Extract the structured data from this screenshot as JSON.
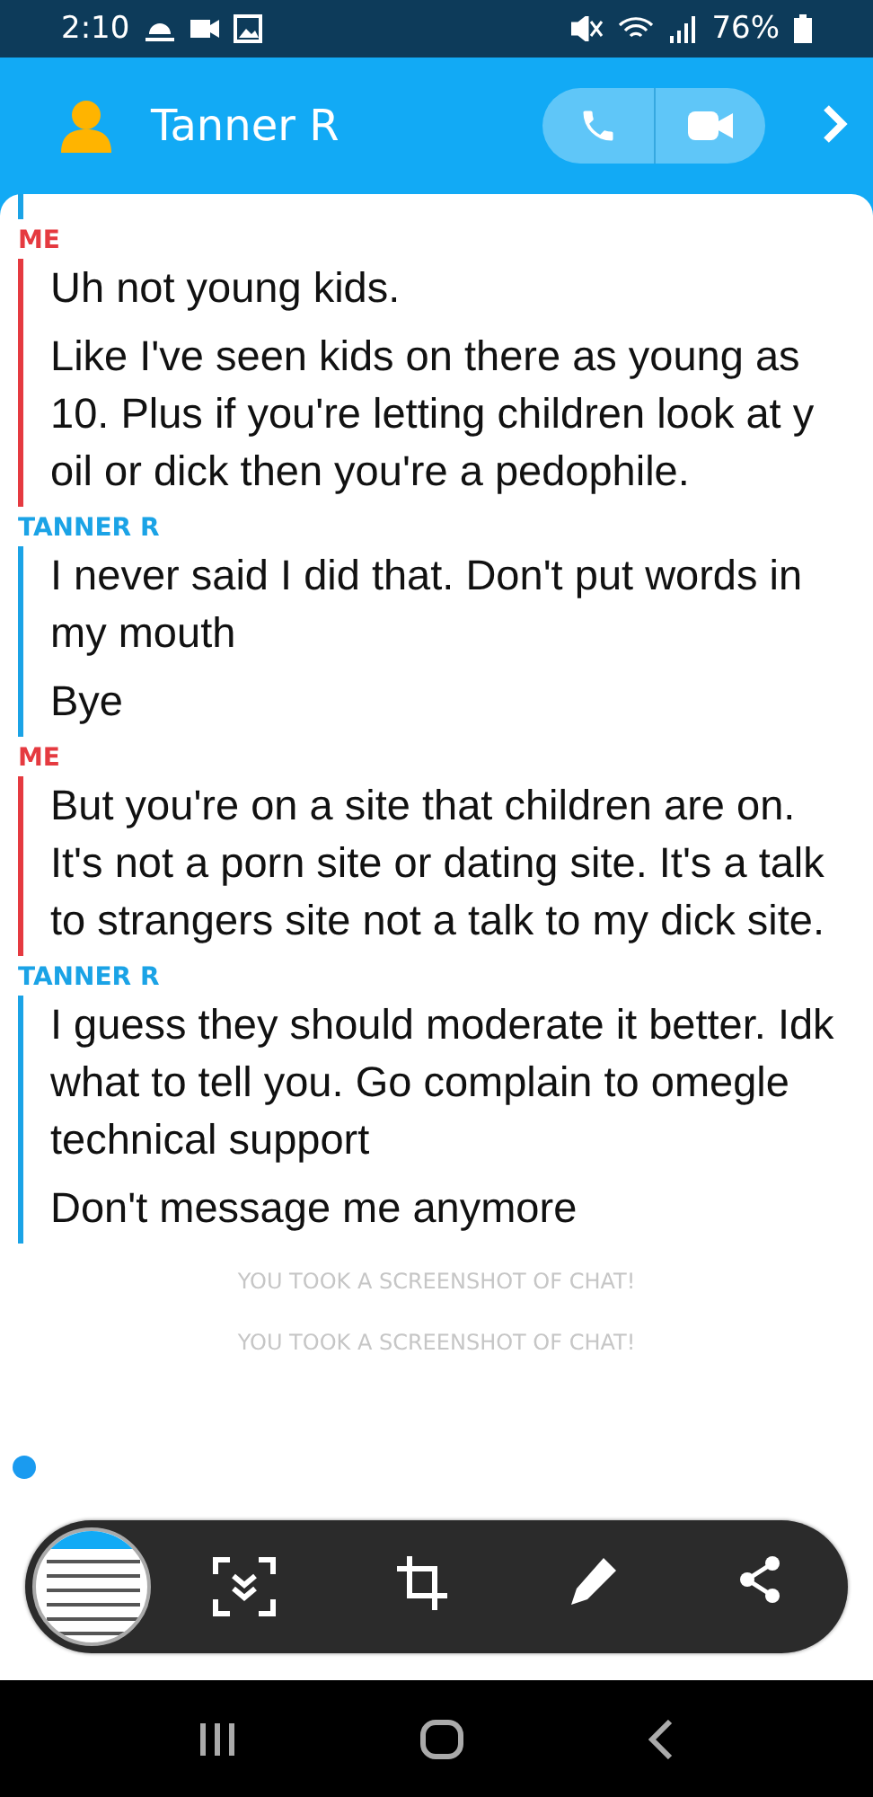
{
  "status_bar": {
    "time": "2:10",
    "battery": "76%"
  },
  "header": {
    "name": "Tanner R"
  },
  "messages": [
    {
      "sender": "ME",
      "kind": "me",
      "texts": [
        "Uh not young kids.",
        "Like I've seen kids on there as young as 10. Plus if you're letting children look at y oil or dick then you're a pedophile."
      ]
    },
    {
      "sender": "TANNER R",
      "kind": "them",
      "texts": [
        "I never said I did that. Don't put words in my mouth",
        "Bye"
      ]
    },
    {
      "sender": "ME",
      "kind": "me",
      "texts": [
        "But you're on a site that children are on. It's not a porn site or dating site. It's a talk to strangers site not a talk to my dick site."
      ]
    },
    {
      "sender": "TANNER R",
      "kind": "them",
      "texts": [
        "I guess they should moderate it better. Idk what to tell you. Go complain to omegle technical support",
        "Don't message me anymore"
      ]
    }
  ],
  "notices": [
    "YOU TOOK A SCREENSHOT OF CHAT!",
    "YOU TOOK A SCREENSHOT OF CHAT!"
  ]
}
